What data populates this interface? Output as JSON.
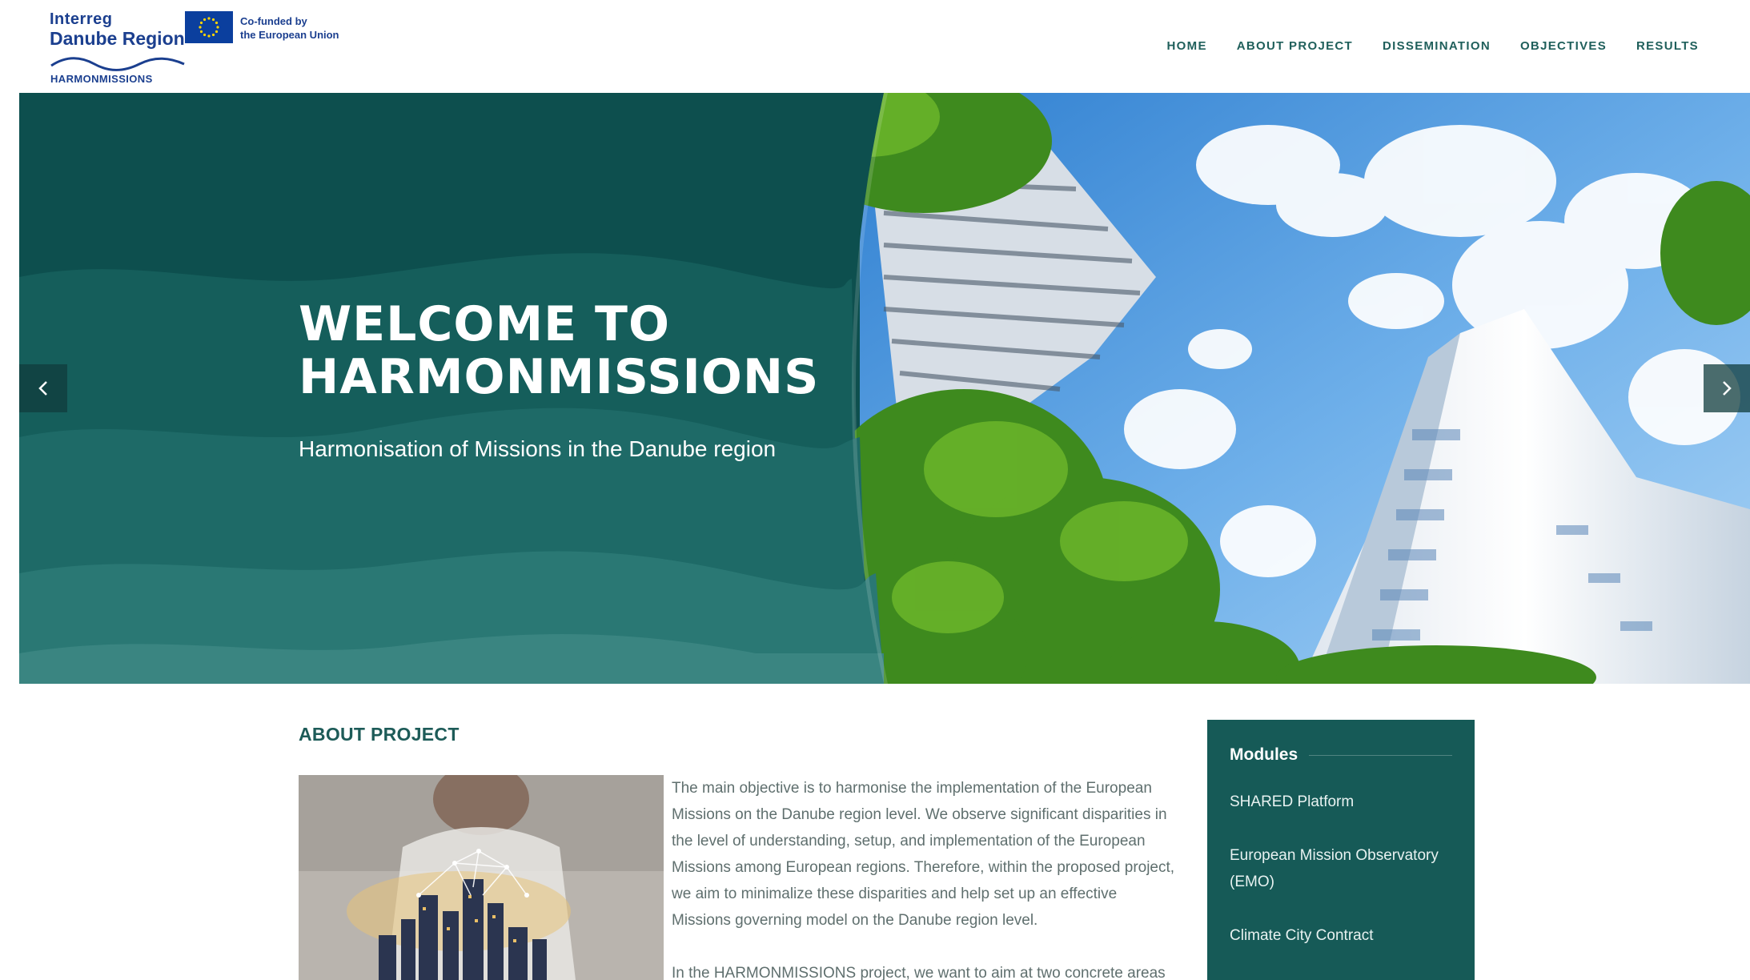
{
  "header": {
    "logo": {
      "interreg": "Interreg",
      "region": "Danube Region",
      "project": "HARMONMISSIONS",
      "cofunded": "Co-funded by\nthe European Union"
    },
    "nav": [
      {
        "label": "HOME"
      },
      {
        "label": "ABOUT PROJECT"
      },
      {
        "label": "DISSEMINATION"
      },
      {
        "label": "OBJECTIVES"
      },
      {
        "label": "RESULTS"
      }
    ]
  },
  "hero": {
    "title_line1": "WELCOME TO",
    "title_line2": "HARMONMISSIONS",
    "subtitle": "Harmonisation of Missions in the Danube region",
    "prev_icon": "chevron-left-icon",
    "next_icon": "chevron-right-icon"
  },
  "about": {
    "heading": "ABOUT PROJECT",
    "paragraph1": "The main objective is to harmonise the implementation of the European Missions on the Danube region level. We observe significant disparities in the level of understanding, setup, and implementation of the European Missions among European regions. Therefore, within the proposed project, we aim to minimalize these disparities and help set up an effective Missions governing model on the Danube region level.",
    "paragraph2": "In the HARMONMISSIONS project, we want to aim at two concrete areas"
  },
  "modules": {
    "title": "Modules",
    "items": [
      {
        "label": "SHARED Platform"
      },
      {
        "label": "European Mission Observatory (EMO)"
      },
      {
        "label": "Climate City Contract"
      }
    ]
  },
  "colors": {
    "brand_teal": "#0d4f4e",
    "sidebar_teal": "#165a57",
    "nav_text": "#1f5f5b",
    "eu_blue": "#0b3f9e",
    "eu_star": "#ffd500"
  }
}
